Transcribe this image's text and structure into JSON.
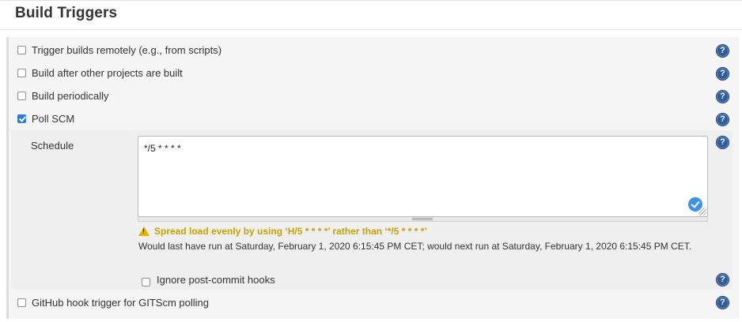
{
  "section": {
    "title": "Build Triggers"
  },
  "triggers": [
    {
      "label": "Trigger builds remotely (e.g., from scripts)",
      "checked": false
    },
    {
      "label": "Build after other projects are built",
      "checked": false
    },
    {
      "label": "Build periodically",
      "checked": false
    },
    {
      "label": "Poll SCM",
      "checked": true
    },
    {
      "label": "GitHub hook trigger for GITScm polling",
      "checked": false
    }
  ],
  "poll_scm": {
    "schedule_label": "Schedule",
    "schedule_value": "*/5 * * * *",
    "warning": "Spread load evenly by using ‘H/5 * * * *’ rather than ‘*/5 * * * *’",
    "run_info": "Would last have run at Saturday, February 1, 2020 6:15:45 PM CET; would next run at Saturday, February 1, 2020 6:15:45 PM CET.",
    "ignore_hooks_label": "Ignore post-commit hooks",
    "ignore_hooks_checked": false
  },
  "icons": {
    "help": "help-icon",
    "valid": "checkmark-circle-icon",
    "warning": "warning-icon"
  },
  "help_glyph": "?",
  "colors": {
    "accent": "#2d7cd6",
    "warning": "#c7a200",
    "help_icon": "#2f5d9c"
  }
}
